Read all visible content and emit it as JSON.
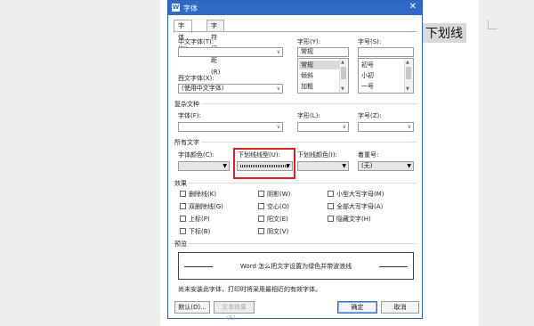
{
  "document": {
    "highlighted_text": "下划线"
  },
  "dialog": {
    "title": "字体",
    "close_glyph": "✕",
    "tabs": [
      "字体(N)",
      "字符间距(R)"
    ],
    "chinese_font_label": "中文字体(T):",
    "chinese_font_value": "",
    "style_label": "字形(Y):",
    "style_value": "常规",
    "style_list": [
      "常规",
      "倾斜",
      "加粗"
    ],
    "size_label": "字号(S):",
    "size_value": "",
    "size_list": [
      "初号",
      "小初",
      "一号"
    ],
    "western_font_label": "西文字体(X):",
    "western_font_value": "(使用中文字体)",
    "complex_section": "复杂文种",
    "complex_font_label": "字体(F):",
    "complex_style_label": "字形(L):",
    "complex_size_label": "字号(Z):",
    "all_text_section": "所有文字",
    "font_color_label": "字体颜色(C):",
    "underline_type_label": "下划线线型(U):",
    "underline_color_label": "下划线颜色(I):",
    "emphasis_label": "着重号:",
    "emphasis_value": "(无)",
    "effects_section": "效果",
    "effects_col1": [
      "删除线(K)",
      "双删除线(G)",
      "上标(P)",
      "下标(B)"
    ],
    "effects_col2": [
      "阴影(W)",
      "空心(O)",
      "阳文(E)",
      "阴文(V)"
    ],
    "effects_col3": [
      "小型大写字母(M)",
      "全部大写字母(A)",
      "隐藏文字(H)"
    ],
    "preview_section": "预览",
    "preview_text": "Word 怎么把文字设置为绿色并带波浪线",
    "note": "尚未安装此字体，打印时将采用最相近的有效字体。",
    "default_button": "默认(D)...",
    "text_effect_button": "文本效果(E)...",
    "ok_button": "确定",
    "cancel_button": "取消"
  }
}
